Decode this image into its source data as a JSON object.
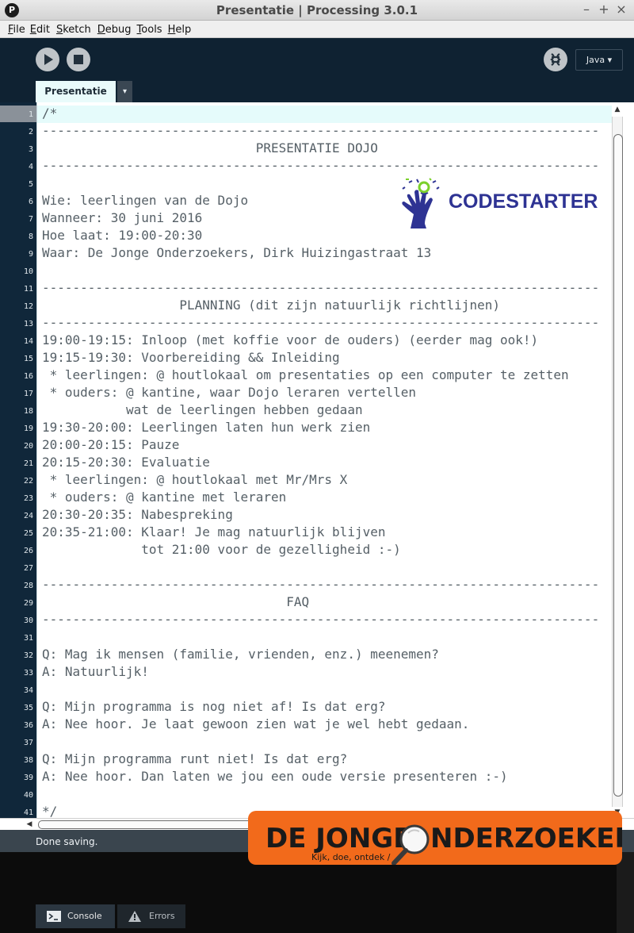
{
  "window": {
    "title": "Presentatie | Processing 3.0.1",
    "app_icon": "P",
    "minimize": "–",
    "maximize": "+",
    "close": "×"
  },
  "menu": {
    "items": [
      {
        "first": "F",
        "rest": "ile"
      },
      {
        "first": "E",
        "rest": "dit"
      },
      {
        "first": "S",
        "rest": "ketch"
      },
      {
        "first": "D",
        "rest": "ebug"
      },
      {
        "first": "T",
        "rest": "ools"
      },
      {
        "first": "H",
        "rest": "elp"
      }
    ]
  },
  "toolbar": {
    "mode_label": "Java ▾",
    "icons": [
      "run-icon",
      "stop-icon",
      "debugger-icon"
    ]
  },
  "tabs": {
    "active": "Presentatie",
    "menu_arrow": "▾"
  },
  "editor": {
    "active_line": 1,
    "line_numbers": [
      "1",
      "2",
      "3",
      "4",
      "5",
      "6",
      "7",
      "8",
      "9",
      "10",
      "11",
      "12",
      "13",
      "14",
      "15",
      "16",
      "17",
      "18",
      "19",
      "20",
      "21",
      "22",
      "23",
      "24",
      "25",
      "26",
      "27",
      "28",
      "29",
      "30",
      "31",
      "32",
      "33",
      "34",
      "35",
      "36",
      "37",
      "38",
      "39",
      "40",
      "41"
    ],
    "lines": [
      "/*",
      "-------------------------------------------------------------------------",
      "                            PRESENTATIE DOJO",
      "-------------------------------------------------------------------------",
      "",
      "Wie: leerlingen van de Dojo",
      "Wanneer: 30 juni 2016",
      "Hoe laat: 19:00-20:30",
      "Waar: De Jonge Onderzoekers, Dirk Huizingastraat 13",
      "",
      "-------------------------------------------------------------------------",
      "                  PLANNING (dit zijn natuurlijk richtlijnen)",
      "-------------------------------------------------------------------------",
      "19:00-19:15: Inloop (met koffie voor de ouders) (eerder mag ook!)",
      "19:15-19:30: Voorbereiding && Inleiding",
      " * leerlingen: @ houtlokaal om presentaties op een computer te zetten",
      " * ouders: @ kantine, waar Dojo leraren vertellen",
      "           wat de leerlingen hebben gedaan",
      "19:30-20:00: Leerlingen laten hun werk zien",
      "20:00-20:15: Pauze",
      "20:15-20:30: Evaluatie",
      " * leerlingen: @ houtlokaal met Mr/Mrs X",
      " * ouders: @ kantine met leraren",
      "20:30-20:35: Nabespreking",
      "20:35-21:00: Klaar! Je mag natuurlijk blijven",
      "             tot 21:00 voor de gezelligheid :-)",
      "",
      "-------------------------------------------------------------------------",
      "                                FAQ",
      "-------------------------------------------------------------------------",
      "",
      "Q: Mag ik mensen (familie, vrienden, enz.) meenemen?",
      "A: Natuurlijk!",
      "",
      "Q: Mijn programma is nog niet af! Is dat erg?",
      "A: Nee hoor. Je laat gewoon zien wat je wel hebt gedaan.",
      "",
      "Q: Mijn programma runt niet! Is dat erg?",
      "A: Nee hoor. Dan laten we jou een oude versie presenteren :-)",
      "",
      "*/"
    ],
    "logo_text": "CODESTARTER",
    "colors": {
      "gutter": "#10273a",
      "text": "#555f66",
      "active_line": "#e5fbfb",
      "logo_blue": "#2e3393",
      "logo_green": "#7bd02c"
    }
  },
  "status": {
    "message": "Done saving."
  },
  "console": {
    "tabs": [
      "Console",
      "Errors"
    ],
    "banner_title_1": "DE JONGE",
    "banner_title_2": "NDERZOEKERS",
    "banner_tagline": "Kijk, doe, ontdek /",
    "banner_color": "#f26a1b"
  }
}
